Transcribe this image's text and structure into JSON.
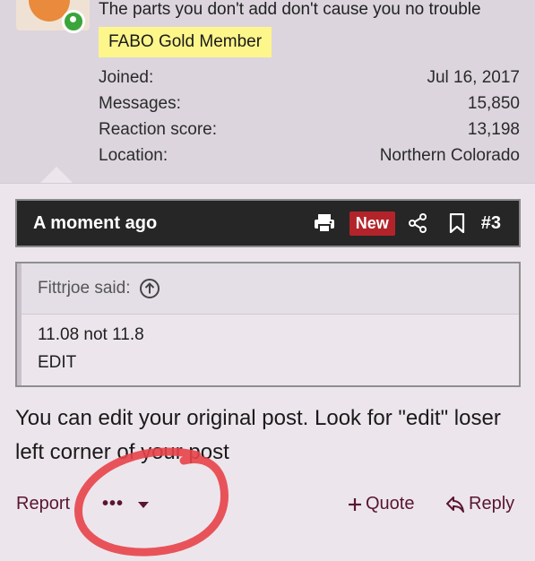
{
  "user": {
    "title": "The parts you don't add don't cause you no trouble",
    "banner": "FABO Gold Member",
    "stats": [
      {
        "label": "Joined:",
        "value": "Jul 16, 2017"
      },
      {
        "label": "Messages:",
        "value": "15,850"
      },
      {
        "label": "Reaction score:",
        "value": "13,198"
      },
      {
        "label": "Location:",
        "value": "Northern Colorado"
      }
    ]
  },
  "post": {
    "time": "A moment ago",
    "new_badge": "New",
    "number": "#3"
  },
  "quote": {
    "author": "Fittrjoe said:",
    "lines": [
      "11.08 not 11.8",
      "EDIT"
    ]
  },
  "message": {
    "text": "You can edit your original post. Look for \"edit\" loser left corner of your post"
  },
  "actions": {
    "report": "Report",
    "more": "•••",
    "quote": "Quote",
    "reply": "Reply"
  },
  "colors": {
    "accent": "#5a1530",
    "new_badge": "#b3242a",
    "banner": "#fdf68b",
    "annotation": "#e8424a"
  }
}
